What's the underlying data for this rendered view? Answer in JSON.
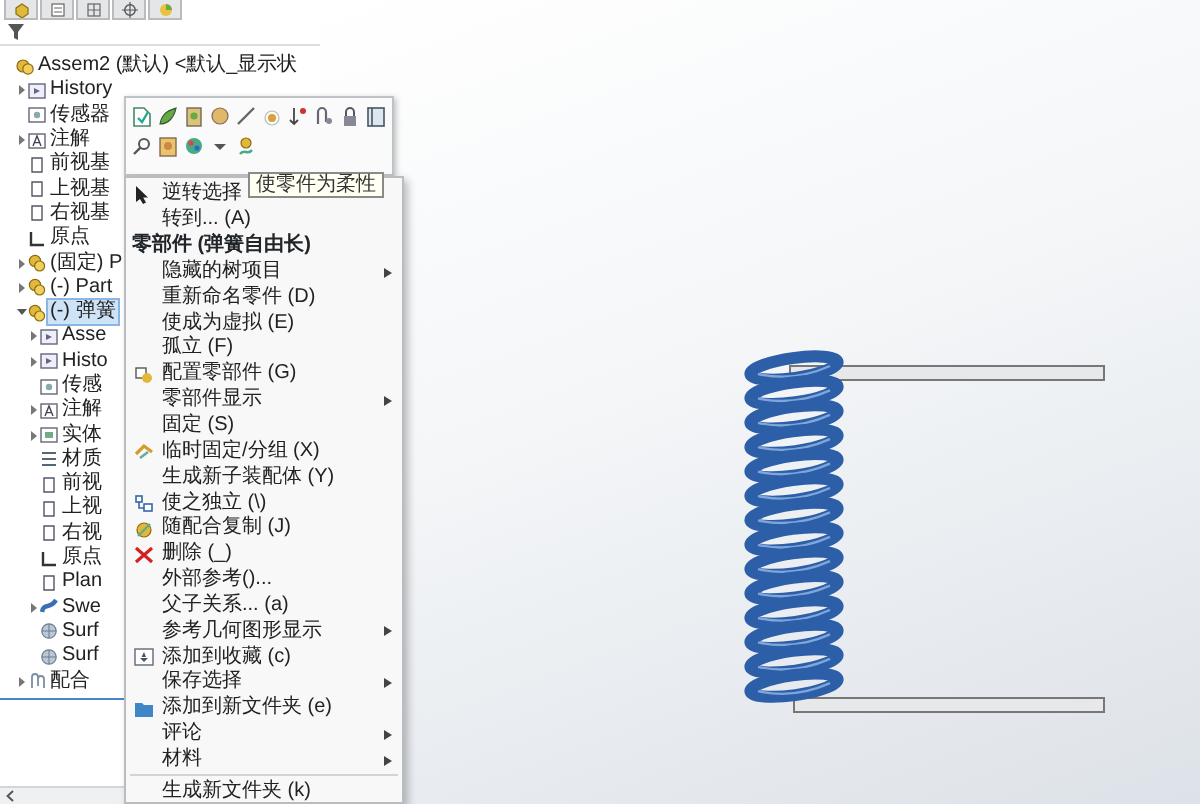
{
  "feature_tree": {
    "items": [
      {
        "label": "Assem2 (默认) <默认_显示状",
        "kind": "assembly",
        "selected": false,
        "children": [
          {
            "label": "History",
            "kind": "history",
            "expanded": false,
            "selected": false
          },
          {
            "label": "传感器",
            "kind": "sensor",
            "selected": false
          },
          {
            "label": "注解",
            "kind": "annotation",
            "expanded": false,
            "selected": false
          },
          {
            "label": "前视基",
            "kind": "plane",
            "selected": false
          },
          {
            "label": "上视基",
            "kind": "plane",
            "selected": false
          },
          {
            "label": "右视基",
            "kind": "plane",
            "selected": false
          },
          {
            "label": "原点",
            "kind": "origin",
            "selected": false
          },
          {
            "label": "(固定) P",
            "kind": "part",
            "expanded": false,
            "selected": false
          },
          {
            "label": "(-) Part",
            "kind": "part",
            "expanded": false,
            "selected": false
          },
          {
            "label": "(-) 弹簧",
            "kind": "part",
            "expanded": true,
            "selected": true,
            "children": [
              {
                "label": "Asse",
                "kind": "history",
                "expanded": false,
                "selected": false
              },
              {
                "label": "Histo",
                "kind": "history",
                "expanded": false,
                "selected": false
              },
              {
                "label": "传感",
                "kind": "sensor",
                "selected": false
              },
              {
                "label": "注解",
                "kind": "annotation",
                "expanded": false,
                "selected": false
              },
              {
                "label": "实体",
                "kind": "solid",
                "expanded": false,
                "selected": false
              },
              {
                "label": "材质",
                "kind": "material",
                "selected": false
              },
              {
                "label": "前视",
                "kind": "plane",
                "selected": false
              },
              {
                "label": "上视",
                "kind": "plane",
                "selected": false
              },
              {
                "label": "右视",
                "kind": "plane",
                "selected": false
              },
              {
                "label": "原点",
                "kind": "origin",
                "selected": false
              },
              {
                "label": "Plan",
                "kind": "plane",
                "selected": false
              },
              {
                "label": "Swe",
                "kind": "sweep",
                "expanded": false,
                "selected": false
              },
              {
                "label": "Surf",
                "kind": "surface",
                "selected": false
              },
              {
                "label": "Surf",
                "kind": "surface",
                "selected": false
              }
            ]
          },
          {
            "label": "配合",
            "kind": "mates",
            "expanded": false,
            "selected": false
          }
        ]
      }
    ]
  },
  "tooltip": {
    "text": "使零件为柔性"
  },
  "context_menu": {
    "items": [
      {
        "kind": "cursor",
        "label": "逆转选择",
        "submenu": false
      },
      {
        "kind": "item",
        "label": "转到... (A)",
        "submenu": false
      },
      {
        "kind": "header",
        "label": "零部件 (弹簧自由长)"
      },
      {
        "kind": "item",
        "label": "隐藏的树项目",
        "submenu": true
      },
      {
        "kind": "item",
        "label": "重新命名零件 (D)",
        "submenu": false
      },
      {
        "kind": "item",
        "label": "使成为虚拟 (E)",
        "submenu": false
      },
      {
        "kind": "item",
        "label": "孤立 (F)",
        "submenu": false
      },
      {
        "kind": "configure",
        "label": "配置零部件 (G)",
        "submenu": false
      },
      {
        "kind": "item",
        "label": "零部件显示",
        "submenu": true
      },
      {
        "kind": "item",
        "label": "固定 (S)",
        "submenu": false
      },
      {
        "kind": "fix",
        "label": "临时固定/分组 (X)",
        "submenu": false
      },
      {
        "kind": "item",
        "label": "生成新子装配体 (Y)",
        "submenu": false
      },
      {
        "kind": "independent",
        "label": "使之独立 (\\)",
        "submenu": false
      },
      {
        "kind": "copy",
        "label": "随配合复制 (J)",
        "submenu": false
      },
      {
        "kind": "delete",
        "label": "删除 (_)",
        "submenu": false
      },
      {
        "kind": "item",
        "label": "外部参考()...",
        "submenu": false
      },
      {
        "kind": "item",
        "label": "父子关系... (a)",
        "submenu": false
      },
      {
        "kind": "item",
        "label": "参考几何图形显示",
        "submenu": true
      },
      {
        "kind": "favorite",
        "label": "添加到收藏 (c)",
        "submenu": false
      },
      {
        "kind": "item",
        "label": "保存选择",
        "submenu": true
      },
      {
        "kind": "folder",
        "label": "添加到新文件夹 (e)",
        "submenu": false
      },
      {
        "kind": "item",
        "label": "评论",
        "submenu": true
      },
      {
        "kind": "item",
        "label": "材料",
        "submenu": true
      },
      {
        "kind": "item",
        "label": "生成新文件夹 (k)",
        "submenu": false,
        "separator_before": true
      }
    ]
  }
}
